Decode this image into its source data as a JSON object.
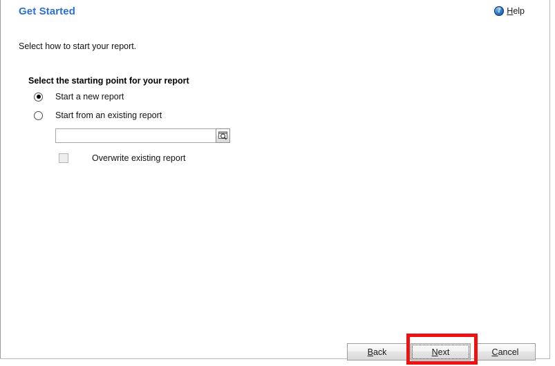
{
  "window": {
    "title": "Get Started"
  },
  "header": {
    "title": "Get Started",
    "help": {
      "icon": "help-circle-icon",
      "accel": "H",
      "rest": "elp"
    }
  },
  "body": {
    "intro_text": "Select how to start your report.",
    "group_label": "Select the starting point for your report",
    "options": [
      {
        "id": "start-new",
        "label": "Start a new report",
        "checked": true
      },
      {
        "id": "start-existing",
        "label": "Start from an existing report",
        "checked": false
      }
    ],
    "existing_report_field": {
      "value": "",
      "placeholder": "",
      "browse_icon": "browse-magnifier-icon"
    },
    "overwrite_checkbox": {
      "label": "Overwrite existing report",
      "checked": false,
      "enabled": false
    }
  },
  "footer": {
    "buttons": [
      {
        "id": "back",
        "accel": "B",
        "rest": "ack",
        "enabled": true,
        "focused": false
      },
      {
        "id": "next",
        "accel": "N",
        "rest": "ext",
        "enabled": true,
        "focused": true
      },
      {
        "id": "cancel",
        "accel": "C",
        "rest": "ancel",
        "enabled": true,
        "focused": false
      }
    ]
  },
  "annotation": {
    "target": "next-button",
    "color": "#ee1111"
  }
}
